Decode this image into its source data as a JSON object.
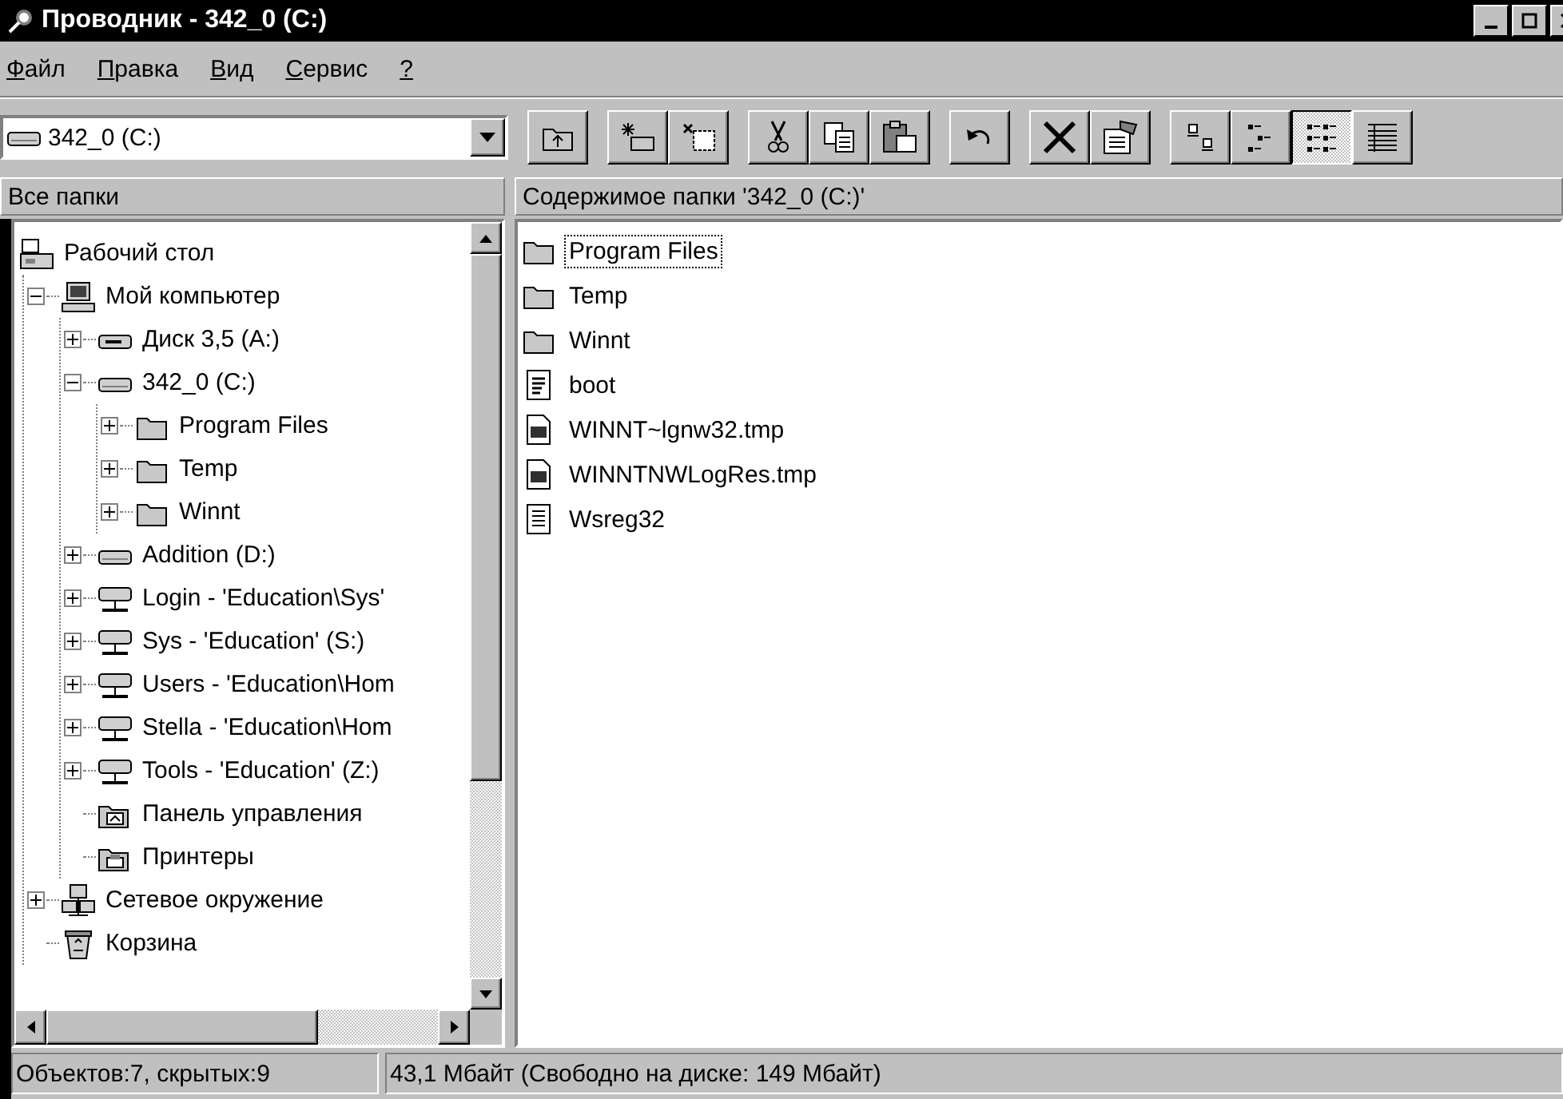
{
  "window": {
    "title": "Проводник - 342_0 (C:)",
    "controls": [
      {
        "kind": "minimize"
      },
      {
        "kind": "maximize"
      },
      {
        "kind": "close"
      }
    ]
  },
  "menu": [
    {
      "label": "Файл"
    },
    {
      "label": "Правка"
    },
    {
      "label": "Вид"
    },
    {
      "label": "Сервис"
    },
    {
      "label": "?"
    }
  ],
  "address": {
    "value": "342_0 (C:)"
  },
  "toolbar": [
    [
      {
        "kind": "up"
      }
    ],
    [
      {
        "kind": "map-drive"
      },
      {
        "kind": "disconnect"
      }
    ],
    [
      {
        "kind": "cut"
      },
      {
        "kind": "copy"
      },
      {
        "kind": "paste"
      }
    ],
    [
      {
        "kind": "undo"
      }
    ],
    [
      {
        "kind": "delete"
      },
      {
        "kind": "properties"
      }
    ],
    [
      {
        "kind": "large-icons",
        "selected": false
      },
      {
        "kind": "small-icons",
        "selected": false
      },
      {
        "kind": "list",
        "selected": true
      },
      {
        "kind": "details",
        "selected": false
      }
    ]
  ],
  "tree": {
    "header": "Все папки",
    "items": [
      {
        "label": "Рабочий стол",
        "kind": "desktop",
        "children": [
          {
            "label": "Мой компьютер",
            "kind": "computer",
            "expanded": true,
            "children": [
              {
                "label": "Диск 3,5 (A:)",
                "kind": "floppy",
                "expanded": false
              },
              {
                "label": "342_0 (C:)",
                "kind": "drive",
                "expanded": true,
                "children": [
                  {
                    "label": "Program Files",
                    "kind": "folder",
                    "expanded": false
                  },
                  {
                    "label": "Temp",
                    "kind": "folder",
                    "expanded": false
                  },
                  {
                    "label": "Winnt",
                    "kind": "folder",
                    "expanded": false
                  }
                ]
              },
              {
                "label": "Addition (D:)",
                "kind": "drive",
                "expanded": false
              },
              {
                "label": "Login - 'Education\\Sys'",
                "kind": "network-drive",
                "expanded": false
              },
              {
                "label": "Sys - 'Education' (S:)",
                "kind": "network-drive",
                "expanded": false
              },
              {
                "label": "Users - 'Education\\Hom",
                "kind": "network-drive",
                "expanded": false
              },
              {
                "label": "Stella - 'Education\\Hom",
                "kind": "network-drive",
                "expanded": false
              },
              {
                "label": "Tools - 'Education' (Z:)",
                "kind": "network-drive",
                "expanded": false
              },
              {
                "label": "Панель управления",
                "kind": "control-panel"
              },
              {
                "label": "Принтеры",
                "kind": "printers"
              }
            ]
          },
          {
            "label": "Сетевое окружение",
            "kind": "network",
            "expanded": false
          },
          {
            "label": "Корзина",
            "kind": "recycle-bin"
          }
        ]
      }
    ]
  },
  "contents": {
    "header": "Содержимое папки '342_0 (C:)'",
    "items": [
      {
        "name": "Program Files",
        "kind": "folder",
        "focused": true
      },
      {
        "name": "Temp",
        "kind": "folder",
        "focused": false
      },
      {
        "name": "Winnt",
        "kind": "folder",
        "focused": false
      },
      {
        "name": "boot",
        "kind": "settings-file",
        "focused": false
      },
      {
        "name": "WINNT~lgnw32.tmp",
        "kind": "app-file",
        "focused": false
      },
      {
        "name": "WINNTNWLogRes.tmp",
        "kind": "app-file",
        "focused": false
      },
      {
        "name": "Wsreg32",
        "kind": "text-file",
        "focused": false
      }
    ]
  },
  "status_bar": [
    "Объектов:7, скрытых:9",
    "43,1 Мбайт (Свободно на диске: 149 Мбайт)"
  ]
}
